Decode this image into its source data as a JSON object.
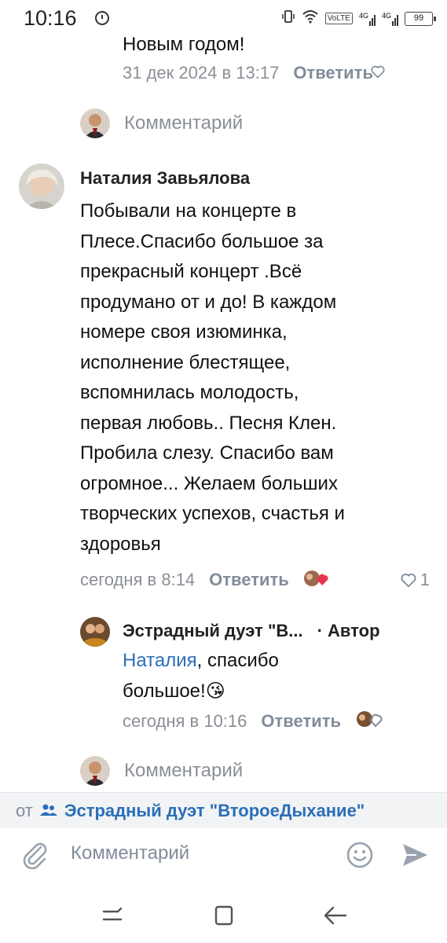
{
  "status_bar": {
    "time": "10:16",
    "network": "VoLTE",
    "signal1": "4G",
    "signal2": "4G",
    "battery": "99"
  },
  "prev_comment": {
    "text_tail": "Новым годом!",
    "timestamp": "31 дек 2024 в 13:17",
    "reply_label": "Ответить"
  },
  "comment_prompt_1": {
    "placeholder": "Комментарий"
  },
  "main_comment": {
    "author": "Наталия Завьялова",
    "lines": [
      "Побывали на концерте в",
      "Плесе.Спасибо большое за",
      "прекрасный концерт .Всё",
      "продумано от и до! В каждом",
      "номере своя изюминка,",
      "исполнение блестящее,",
      "вспомнилась молодость,",
      "первая любовь.. Песня Клен.",
      "Пробила слезу. Спасибо вам",
      "огромное... Желаем  больших",
      "творческих успехов, счастья и",
      "здоровья"
    ],
    "timestamp": "сегодня в 8:14",
    "reply_label": "Ответить",
    "like_count": "1"
  },
  "reply": {
    "author": "Эстрадный дуэт \"В...",
    "badge": "· Автор",
    "mention": "Наталия",
    "text_1": ", спасибо",
    "text_2": "большое!",
    "emoji": "😘",
    "timestamp": "сегодня в 10:16",
    "reply_label": "Ответить"
  },
  "comment_prompt_2": {
    "placeholder": "Комментарий"
  },
  "from_bar": {
    "prefix": "от",
    "name": "Эстрадный дуэт \"ВтороеДыхание\""
  },
  "composer": {
    "placeholder": "Комментарий"
  },
  "colors": {
    "link": "#2a6fb8",
    "muted": "#818c99",
    "bar_bg": "#f2f3f5"
  }
}
